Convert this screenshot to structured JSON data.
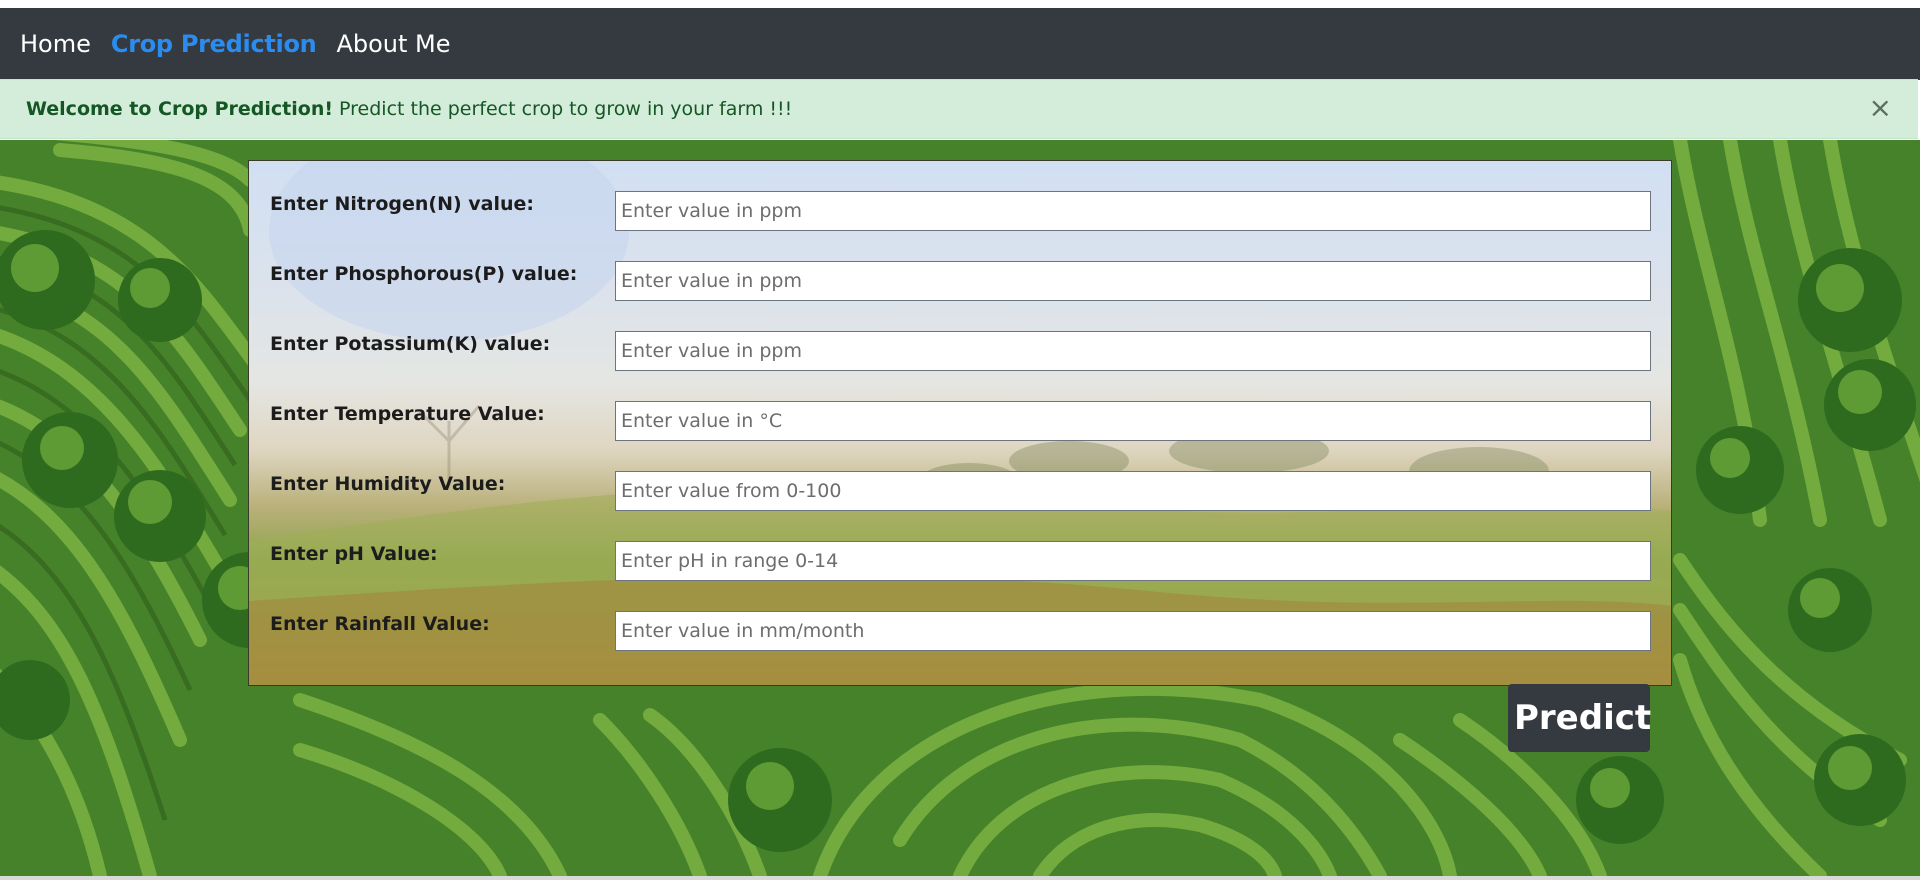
{
  "nav": {
    "items": [
      {
        "label": "Home",
        "active": false
      },
      {
        "label": "Crop Prediction",
        "active": true
      },
      {
        "label": "About Me",
        "active": false
      }
    ]
  },
  "alert": {
    "strong": "Welcome to Crop Prediction!",
    "text": "Predict the perfect crop to grow in your farm !!!",
    "close": "×"
  },
  "form": {
    "fields": [
      {
        "label": "Enter Nitrogen(N) value:",
        "placeholder": "Enter value in ppm"
      },
      {
        "label": "Enter Phosphorous(P) value:",
        "placeholder": "Enter value in ppm"
      },
      {
        "label": "Enter Potassium(K) value:",
        "placeholder": "Enter value in ppm"
      },
      {
        "label": "Enter Temperature Value:",
        "placeholder": "Enter value in °C"
      },
      {
        "label": "Enter Humidity Value:",
        "placeholder": "Enter value from 0-100"
      },
      {
        "label": "Enter pH Value:",
        "placeholder": "Enter pH in range 0-14"
      },
      {
        "label": "Enter Rainfall Value:",
        "placeholder": "Enter value in mm/month"
      }
    ],
    "submit_label": "Predict"
  },
  "colors": {
    "navbar_bg": "#343a40",
    "nav_active": "#2b8cf0",
    "alert_bg": "#d4ecda",
    "alert_text": "#155724",
    "button_bg": "#343a40"
  }
}
